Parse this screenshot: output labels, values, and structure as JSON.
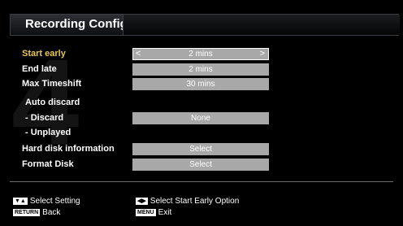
{
  "menu": {
    "title": "Recording Configuration"
  },
  "rows": [
    {
      "label": "Start early",
      "value": "2 mins",
      "highlighted": true
    },
    {
      "label": "End late",
      "value": "2 mins"
    },
    {
      "label": "Max Timeshift",
      "value": "30 mins"
    },
    {
      "label": "Auto discard",
      "value": ""
    },
    {
      "label": "- Discard",
      "value": "None"
    },
    {
      "label": "- Unplayed",
      "value": ""
    },
    {
      "label": "Hard disk information",
      "value": "Select"
    },
    {
      "label": "Format Disk",
      "value": "Select"
    }
  ],
  "hints": {
    "select_setting": "Select Setting",
    "back": "Back",
    "select_option": "Select Start Early Option",
    "exit": "Exit",
    "keys": {
      "updown": "▼▲",
      "return": "RETURN",
      "leftright": "◀▶",
      "menu": "MENU"
    }
  },
  "colors": {
    "highlight_label": "#e8c64a",
    "field_bg": "#a8a8a8",
    "header_border": "#3a3f45"
  }
}
